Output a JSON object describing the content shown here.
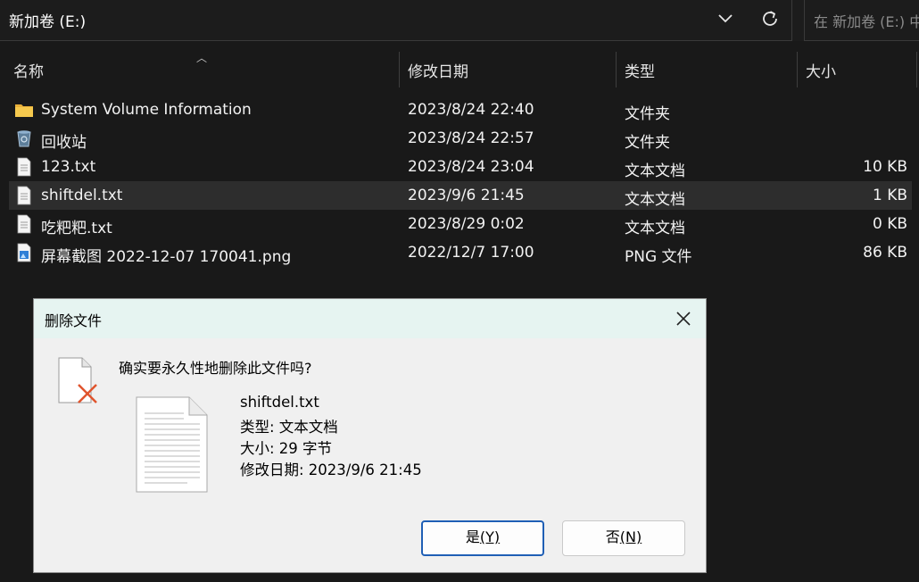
{
  "address": {
    "path": "新加卷 (E:)",
    "search_placeholder": "在 新加卷 (E:) 中"
  },
  "columns": {
    "name": "名称",
    "modified": "修改日期",
    "type": "类型",
    "size": "大小"
  },
  "files": [
    {
      "name": "System Volume Information",
      "modified": "2023/8/24 22:40",
      "type": "文件夹",
      "size": "",
      "icon": "folder-icon"
    },
    {
      "name": "回收站",
      "modified": "2023/8/24 22:57",
      "type": "文件夹",
      "size": "",
      "icon": "recycle-bin-icon"
    },
    {
      "name": "123.txt",
      "modified": "2023/8/24 23:04",
      "type": "文本文档",
      "size": "10 KB",
      "icon": "text-file-icon"
    },
    {
      "name": "shiftdel.txt",
      "modified": "2023/9/6 21:45",
      "type": "文本文档",
      "size": "1 KB",
      "icon": "text-file-icon"
    },
    {
      "name": "吃粑粑.txt",
      "modified": "2023/8/29 0:02",
      "type": "文本文档",
      "size": "0 KB",
      "icon": "text-file-icon"
    },
    {
      "name": "屏幕截图 2022-12-07 170041.png",
      "modified": "2022/12/7 17:00",
      "type": "PNG 文件",
      "size": "86 KB",
      "icon": "image-file-icon"
    }
  ],
  "dialog": {
    "title": "删除文件",
    "question": "确实要永久性地删除此文件吗?",
    "file_name": "shiftdel.txt",
    "file_type": "类型: 文本文档",
    "file_size": "大小: 29 字节",
    "file_modified": "修改日期: 2023/9/6 21:45",
    "yes_label": "是",
    "yes_key": "(Y)",
    "no_label": "否",
    "no_key": "(N)"
  },
  "colors": {
    "background": "#191919",
    "selected_row": "#2d2d2d",
    "dialog_title_bg": "#e6f4f1",
    "primary_button_border": "#1f5fb5",
    "delete_x": "#e0542d"
  }
}
